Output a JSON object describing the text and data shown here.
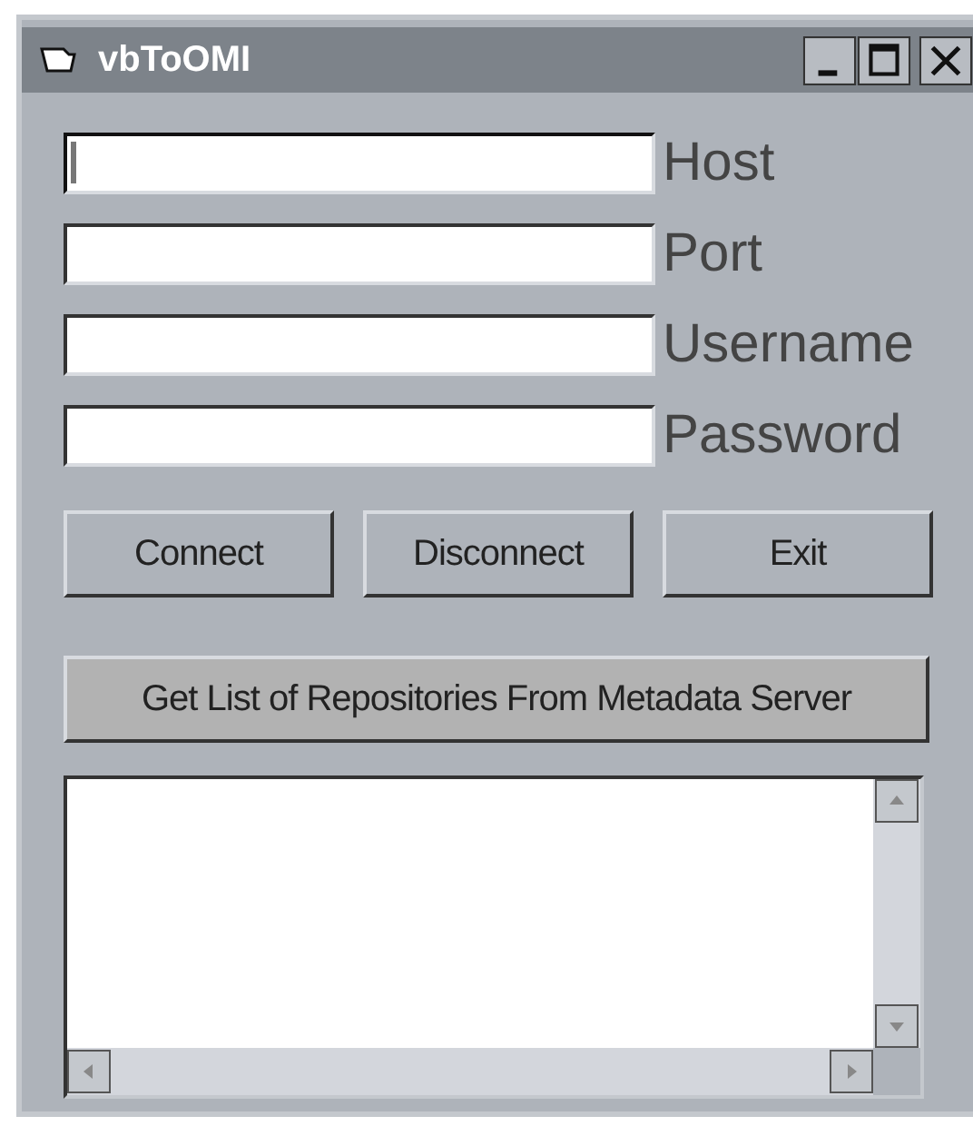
{
  "window": {
    "title": "vbToOMI"
  },
  "fields": [
    {
      "label": "Host",
      "focused": true
    },
    {
      "label": "Port",
      "focused": false
    },
    {
      "label": "Username",
      "focused": false
    },
    {
      "label": "Password",
      "focused": false
    }
  ],
  "buttons": [
    "Connect",
    "Disconnect",
    "Exit"
  ],
  "list_button": "Get List of Repositories From Metadata Server"
}
